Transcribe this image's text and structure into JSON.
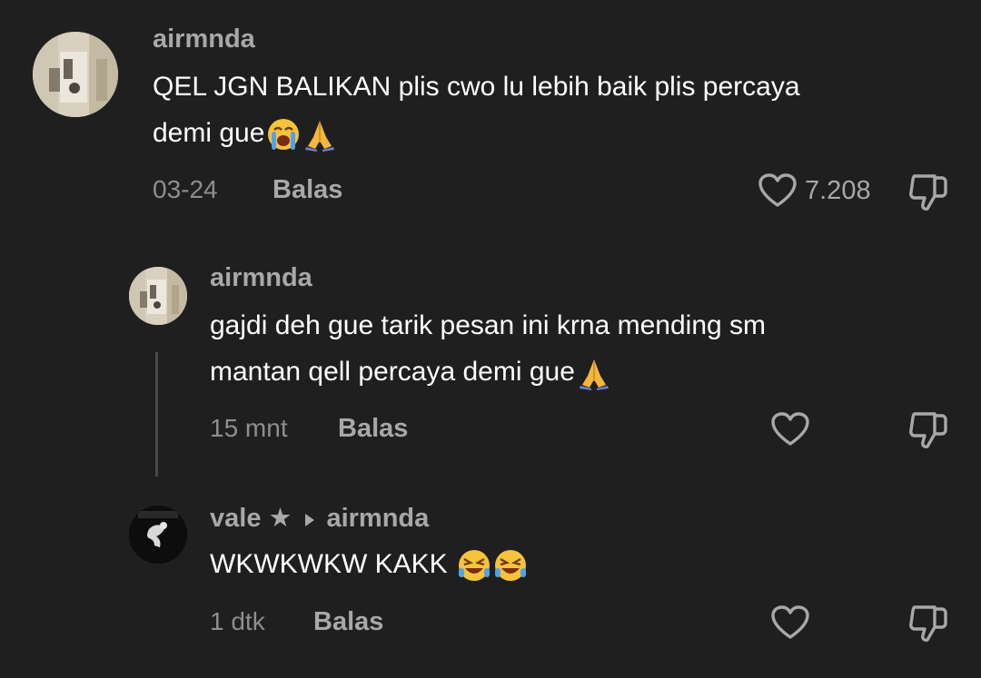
{
  "comments": [
    {
      "username": "airmnda",
      "line1": "QEL JGN BALIKAN plis cwo lu lebih baik plis percaya",
      "line2": "demi gue",
      "time": "03-24",
      "reply_label": "Balas",
      "likes": "7.208"
    },
    {
      "username": "airmnda",
      "line1": "gajdi deh gue tarik pesan ini krna mending sm",
      "line2": "mantan qell percaya demi gue",
      "time": "15 mnt",
      "reply_label": "Balas"
    },
    {
      "username": "vale",
      "star": "★",
      "reply_to": "airmnda",
      "line1": "WKWKWKW KAKK",
      "time": "1 dtk",
      "reply_label": "Balas"
    }
  ],
  "icons": {
    "like": "heart-outline-icon",
    "dislike": "thumbs-down-outline-icon",
    "emojis": [
      "loudly-crying-face",
      "folded-hands",
      "rolling-on-floor-laughing"
    ]
  },
  "colors": {
    "background": "#1f1f1f",
    "username": "#a8a8a8",
    "text": "#ffffff",
    "meta": "#8e8e8e"
  }
}
